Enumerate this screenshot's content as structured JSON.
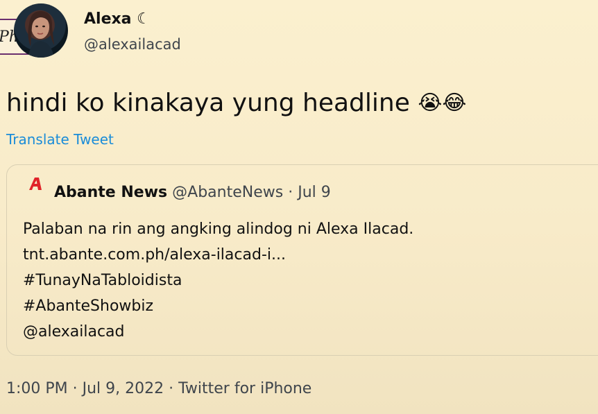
{
  "corner_tag": "Ph",
  "author": {
    "name": "Alexa ☾",
    "handle": "@alexailacad",
    "avatar_icon": "profile-photo"
  },
  "tweet": {
    "text": "hindi ko kinakaya yung headline",
    "emojis": [
      "😭",
      "😂"
    ],
    "translate_label": "Translate Tweet"
  },
  "quote": {
    "logo_icon": "abante-logo",
    "logo_color": "#e0232a",
    "name": "Abante News",
    "handle": "@AbanteNews",
    "separator": "·",
    "date": "Jul 9",
    "lines": [
      "Palaban na rin ang angking alindog ni Alexa Ilacad.",
      "tnt.abante.com.ph/alexa-ilacad-i...",
      "#TunayNaTabloidista",
      "#AbanteShowbiz",
      "@alexailacad"
    ]
  },
  "timestamp": "1:00 PM · Jul 9, 2022 · Twitter for iPhone",
  "colors": {
    "background": "#fbf0cf",
    "link": "#1a8cd8",
    "secondary_text": "#3f454c"
  }
}
